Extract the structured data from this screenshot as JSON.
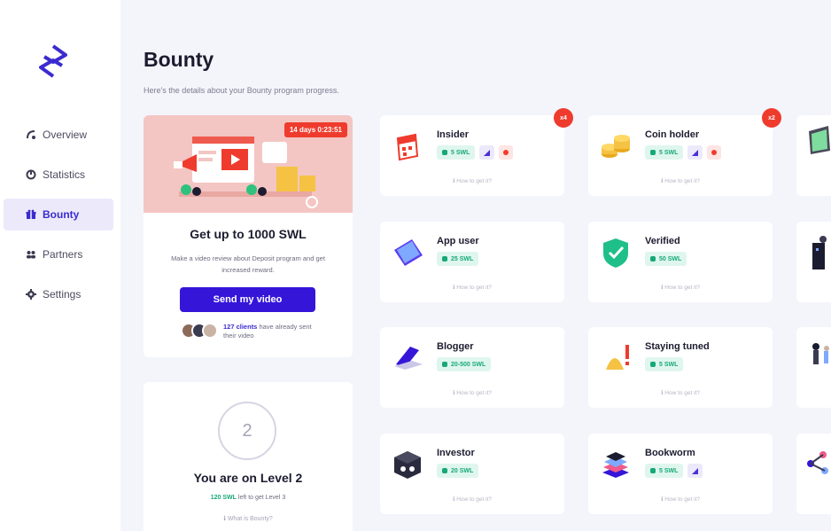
{
  "sidebar": {
    "items": [
      {
        "label": "Overview",
        "icon": "overview-icon"
      },
      {
        "label": "Statistics",
        "icon": "statistics-icon"
      },
      {
        "label": "Bounty",
        "icon": "gift-icon"
      },
      {
        "label": "Partners",
        "icon": "partners-icon"
      },
      {
        "label": "Settings",
        "icon": "gear-icon"
      }
    ],
    "active_index": 2
  },
  "header": {
    "title": "Bounty",
    "subtitle": "Here's the details about your Bounty program progress."
  },
  "promo": {
    "timer": "14 days 0:23:51",
    "title": "Get up to 1000 SWL",
    "description": "Make a video review about Deposit program and get increased reward.",
    "button_label": "Send my video",
    "clients_highlight": "127 clients",
    "clients_text": "have already sent their video"
  },
  "level": {
    "number": "2",
    "title": "You are on Level 2",
    "left_highlight": "120 SWL",
    "left_text": "left to get Level 3",
    "what_link": "What is Bounty?"
  },
  "cards": [
    {
      "title": "Insider",
      "reward": "5 SWL",
      "howto": "How to get it?",
      "corner": "x4"
    },
    {
      "title": "Coin holder",
      "reward": "5 SWL",
      "howto": "How to get it?",
      "corner": "x2"
    },
    {
      "title": "App user",
      "reward": "25 SWL",
      "howto": "How to get it?"
    },
    {
      "title": "Verified",
      "reward": "50 SWL",
      "howto": "How to get it?"
    },
    {
      "title": "Blogger",
      "reward": "20-500 SWL",
      "howto": "How to get it?"
    },
    {
      "title": "Staying tuned",
      "reward": "5 SWL",
      "howto": "How to get it?"
    },
    {
      "title": "Investor",
      "reward": "20 SWL",
      "howto": "How to get it?"
    },
    {
      "title": "Bookworm",
      "reward": "5 SWL",
      "howto": "How to get it?"
    }
  ],
  "colors": {
    "accent": "#3516d9",
    "reward_green": "#16a878",
    "alert_red": "#ef3b2d",
    "background": "#f4f5fa"
  }
}
